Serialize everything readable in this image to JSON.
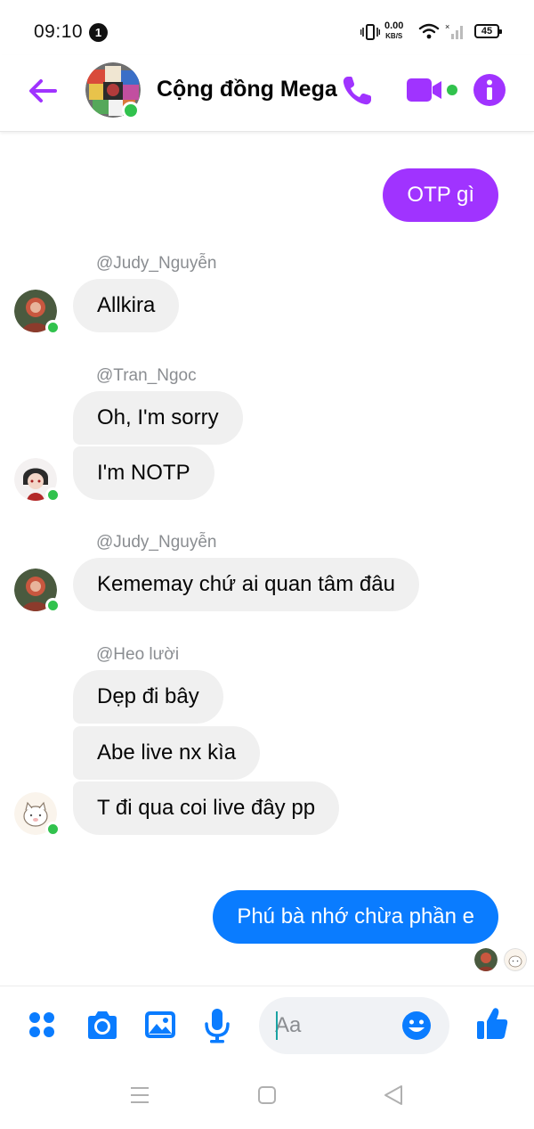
{
  "status_bar": {
    "time": "09:10",
    "notification_count": "1",
    "net_speed_value": "0.00",
    "net_speed_unit": "KB/S",
    "battery": "45"
  },
  "header": {
    "title": "Cộng đồng Mega",
    "accent_color": "#a033ff"
  },
  "messages": {
    "m1": {
      "text": "OTP gì"
    },
    "sender1": "@Judy_Nguyễn",
    "m2": {
      "text": "Allkira"
    },
    "sender2": "@Tran_Ngoc",
    "m3": {
      "text": "Oh, I'm sorry"
    },
    "m4": {
      "text": "I'm NOTP"
    },
    "sender3": "@Judy_Nguyễn",
    "m5": {
      "text": "Kememay chứ ai quan tâm đâu"
    },
    "sender4": "@Heo lười",
    "m6": {
      "text": "Dẹp đi bây"
    },
    "m7": {
      "text": "Abe live nx kìa"
    },
    "m8": {
      "text": "T đi qua coi live đây pp"
    },
    "m9": {
      "text": "Phú bà nhớ chừa phần e"
    }
  },
  "composer": {
    "placeholder": "Aa"
  },
  "colors": {
    "outgoing_purple": "#a033ff",
    "outgoing_blue": "#0a7cff",
    "incoming_bg": "#f0f0f0",
    "online_green": "#31c24d",
    "icon_blue": "#0a7cff"
  },
  "icons": {
    "status": [
      "vibrate-icon",
      "wifi-icon",
      "signal-icon",
      "battery-icon"
    ],
    "header": [
      "back-arrow-icon",
      "phone-icon",
      "video-camera-icon",
      "info-icon"
    ],
    "composer": [
      "apps-menu-icon",
      "camera-icon",
      "gallery-icon",
      "microphone-icon",
      "emoji-icon",
      "thumbs-up-icon"
    ],
    "nav": [
      "menu-icon",
      "home-icon",
      "back-icon"
    ]
  }
}
